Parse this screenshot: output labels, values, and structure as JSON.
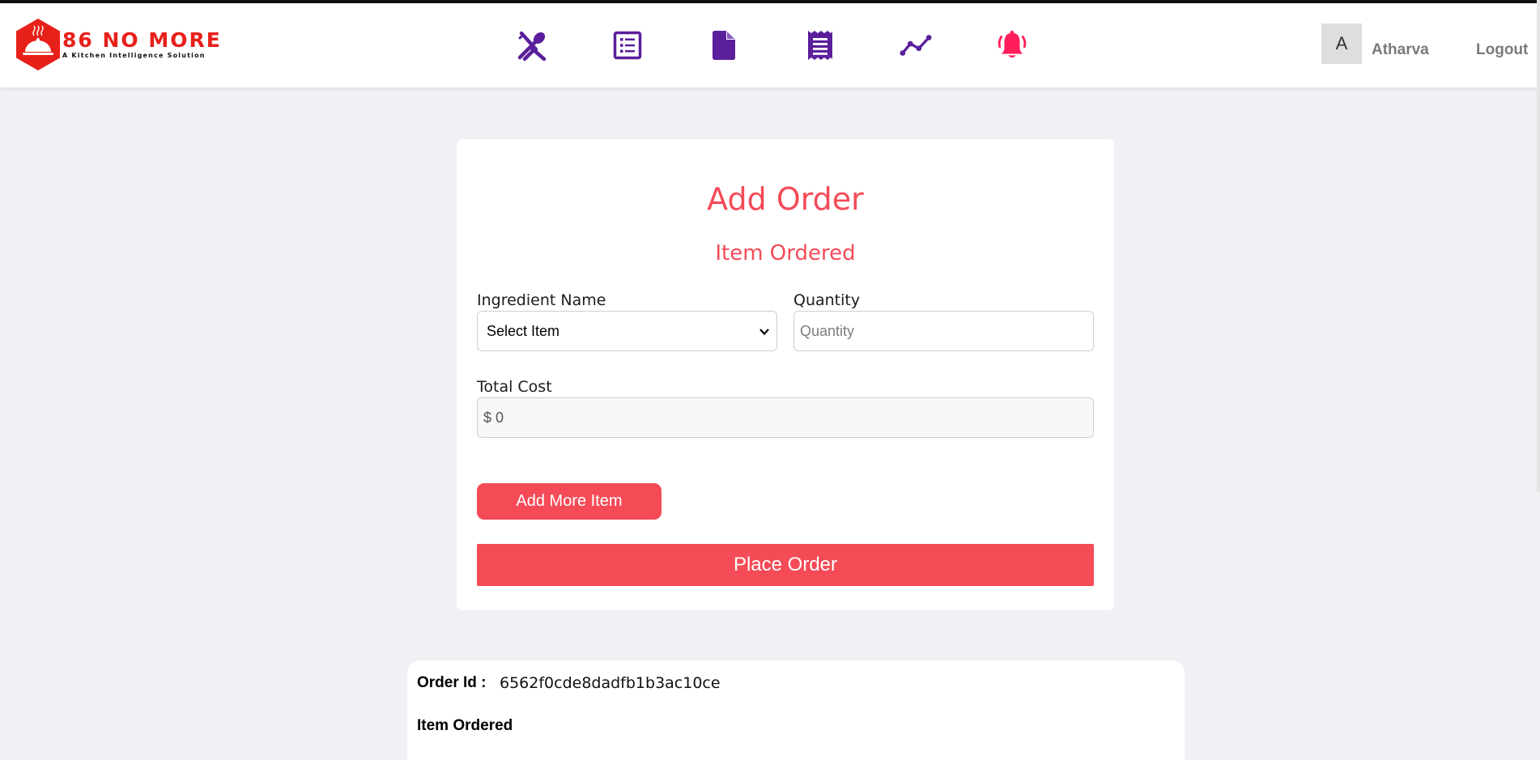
{
  "brand": {
    "name": "86 NO MORE",
    "tagline": "A Kitchen Intelligence Solution"
  },
  "nav": {
    "icons": [
      {
        "name": "utensils-icon",
        "color": "#5b1f9b"
      },
      {
        "name": "list-icon",
        "color": "#5b1f9b"
      },
      {
        "name": "file-icon",
        "color": "#5b1f9b"
      },
      {
        "name": "receipt-icon",
        "color": "#5b1f9b"
      },
      {
        "name": "trend-line-icon",
        "color": "#5b1f9b"
      },
      {
        "name": "bell-icon",
        "color": "#ff1e5a"
      }
    ]
  },
  "user": {
    "initial": "A",
    "name": "Atharva",
    "logout_label": "Logout"
  },
  "form": {
    "title": "Add Order",
    "subtitle": "Item Ordered",
    "ingredient_label": "Ingredient Name",
    "ingredient_selected": "Select Item",
    "quantity_label": "Quantity",
    "quantity_placeholder": "Quantity",
    "total_cost_label": "Total Cost",
    "total_cost_value": "$ 0",
    "add_more_label": "Add More Item",
    "place_order_label": "Place Order"
  },
  "order": {
    "id_label": "Order Id :",
    "id_value": "6562f0cde8dadfb1b3ac10ce",
    "items_label": "Item Ordered"
  },
  "colors": {
    "accent": "#f44b57",
    "nav_icon": "#5b1f9b",
    "bell": "#ff1e5a",
    "brand": "#e8201a",
    "background": "#f0f1f5"
  }
}
